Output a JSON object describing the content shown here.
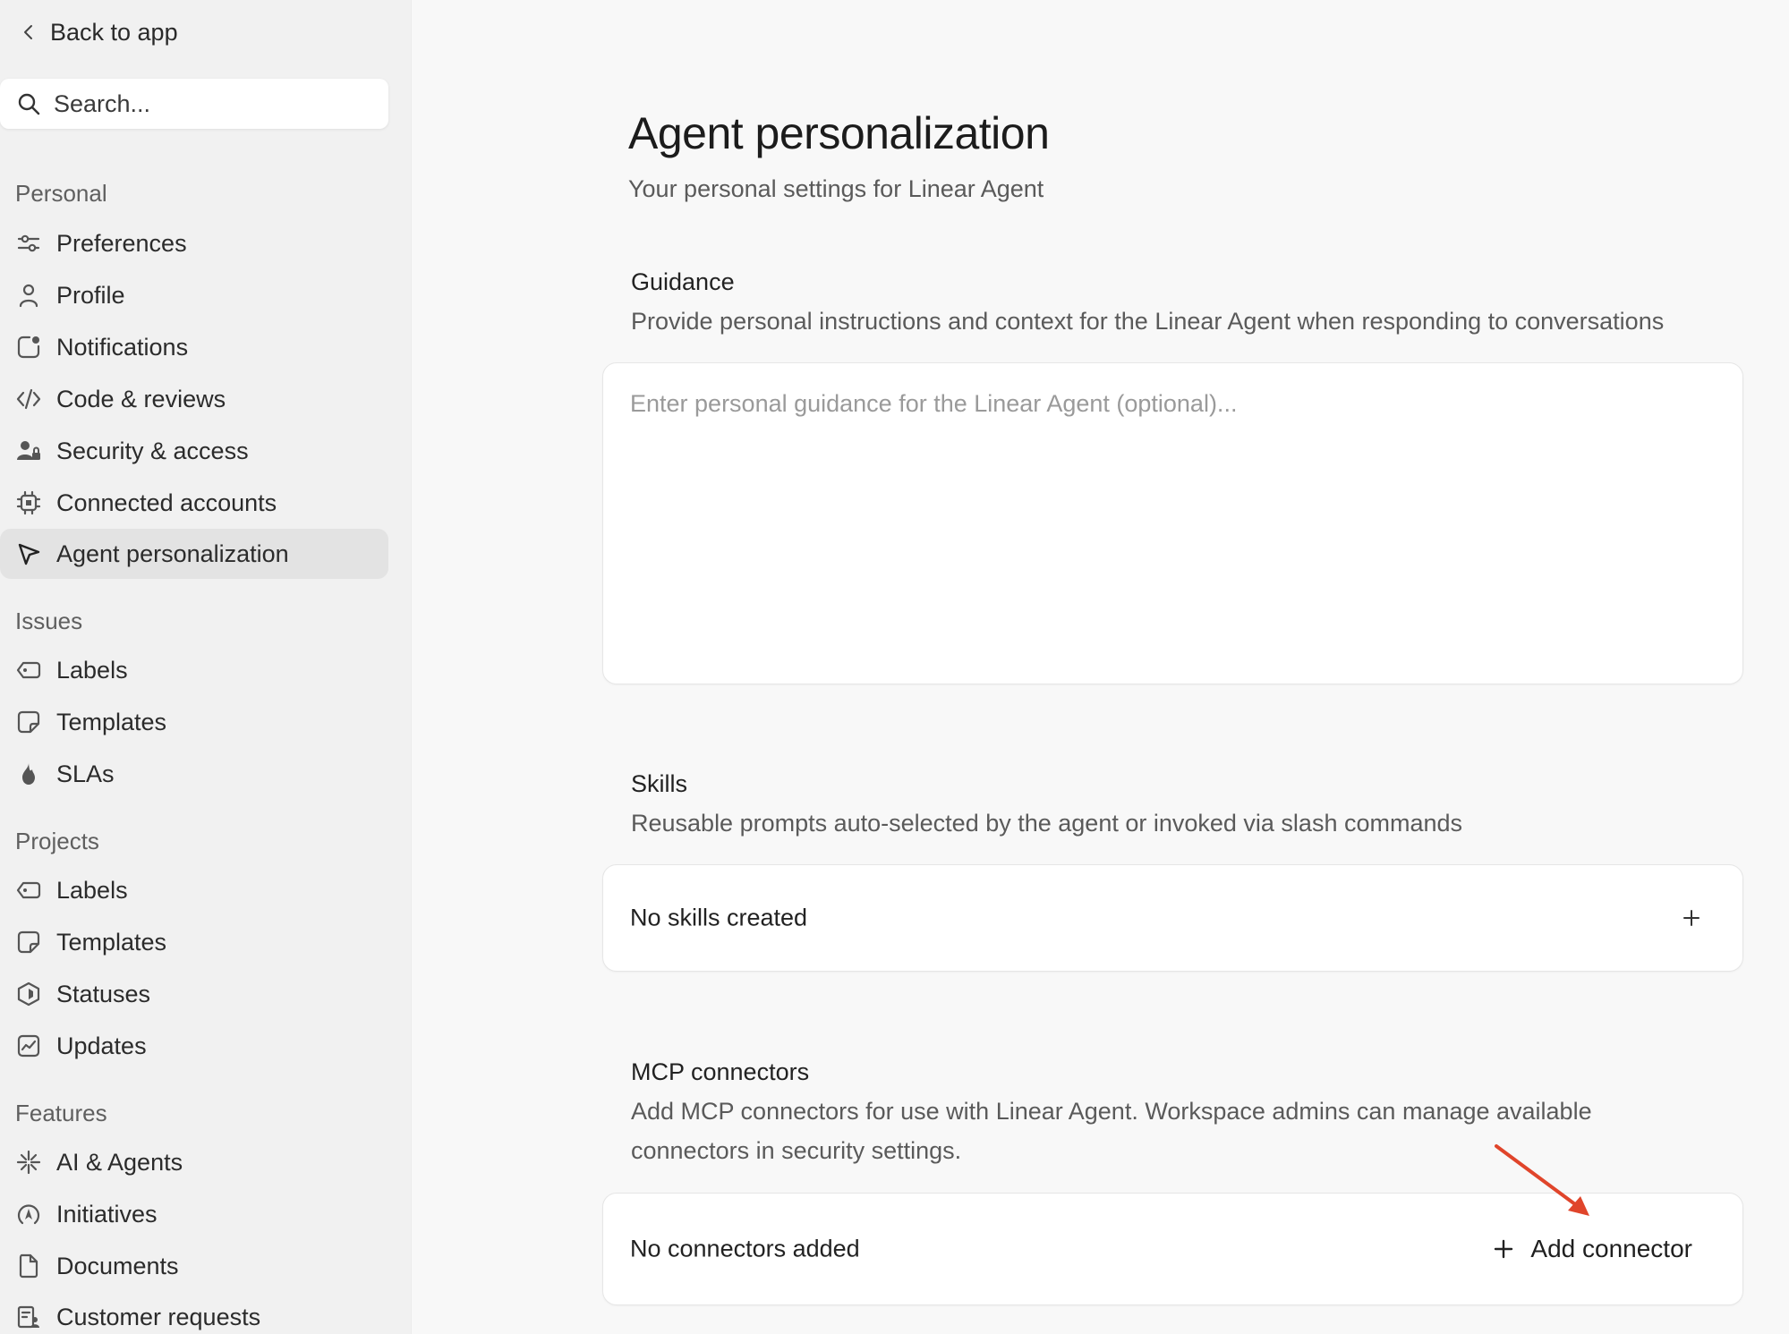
{
  "sidebar": {
    "back_label": "Back to app",
    "search_placeholder": "Search...",
    "sections": [
      {
        "title": "Personal",
        "items": [
          {
            "label": "Preferences",
            "icon": "sliders-icon"
          },
          {
            "label": "Profile",
            "icon": "person-icon"
          },
          {
            "label": "Notifications",
            "icon": "bell-dot-icon"
          },
          {
            "label": "Code & reviews",
            "icon": "code-icon"
          },
          {
            "label": "Security & access",
            "icon": "users-lock-icon"
          },
          {
            "label": "Connected accounts",
            "icon": "chip-icon"
          },
          {
            "label": "Agent personalization",
            "icon": "cursor-arrow-icon",
            "active": true
          }
        ]
      },
      {
        "title": "Issues",
        "items": [
          {
            "label": "Labels",
            "icon": "tag-icon"
          },
          {
            "label": "Templates",
            "icon": "template-icon"
          },
          {
            "label": "SLAs",
            "icon": "flame-icon"
          }
        ]
      },
      {
        "title": "Projects",
        "items": [
          {
            "label": "Labels",
            "icon": "tag-icon"
          },
          {
            "label": "Templates",
            "icon": "template-icon"
          },
          {
            "label": "Statuses",
            "icon": "hexagon-icon"
          },
          {
            "label": "Updates",
            "icon": "chart-line-icon"
          }
        ]
      },
      {
        "title": "Features",
        "items": [
          {
            "label": "AI & Agents",
            "icon": "sparkle-icon"
          },
          {
            "label": "Initiatives",
            "icon": "compass-icon"
          },
          {
            "label": "Documents",
            "icon": "document-icon"
          },
          {
            "label": "Customer requests",
            "icon": "customer-request-icon"
          }
        ]
      }
    ]
  },
  "main": {
    "title": "Agent personalization",
    "subtitle": "Your personal settings for Linear Agent",
    "guidance": {
      "heading": "Guidance",
      "description": "Provide personal instructions and context for the Linear Agent when responding to conversations",
      "placeholder": "Enter personal guidance for the Linear Agent (optional)..."
    },
    "skills": {
      "heading": "Skills",
      "description": "Reusable prompts auto-selected by the agent or invoked via slash commands",
      "empty_text": "No skills created"
    },
    "mcp": {
      "heading": "MCP connectors",
      "description_line1": "Add MCP connectors for use with Linear Agent. Workspace admins can manage available",
      "description_line2": "connectors in security settings.",
      "empty_text": "No connectors added",
      "add_label": "Add connector"
    }
  },
  "colors": {
    "annotation_arrow": "#e0452b",
    "active_nav_bg": "#e3e3e3"
  }
}
